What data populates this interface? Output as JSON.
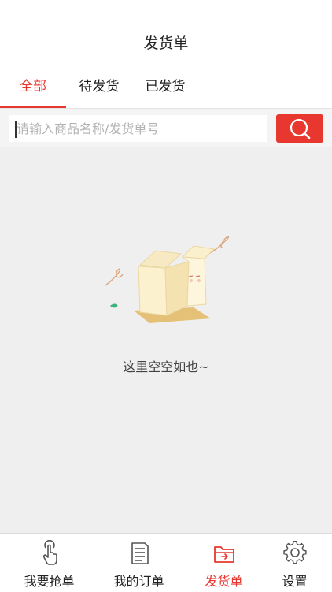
{
  "header": {
    "title": "发货单"
  },
  "tabs": [
    {
      "label": "全部",
      "active": true
    },
    {
      "label": "待发货",
      "active": false
    },
    {
      "label": "已发货",
      "active": false
    }
  ],
  "search": {
    "placeholder": "请输入商品名称/发货单号",
    "value": ""
  },
  "empty_state": {
    "message": "这里空空如也~",
    "icon": "empty-box-illustration"
  },
  "tabbar": [
    {
      "label": "我要抢单",
      "icon": "tap-hand-icon",
      "active": false
    },
    {
      "label": "我的订单",
      "icon": "document-icon",
      "active": false
    },
    {
      "label": "发货单",
      "icon": "folder-icon",
      "active": true
    },
    {
      "label": "设置",
      "icon": "gear-icon",
      "active": false
    }
  ],
  "colors": {
    "accent": "#e8372f",
    "background": "#efefef"
  }
}
